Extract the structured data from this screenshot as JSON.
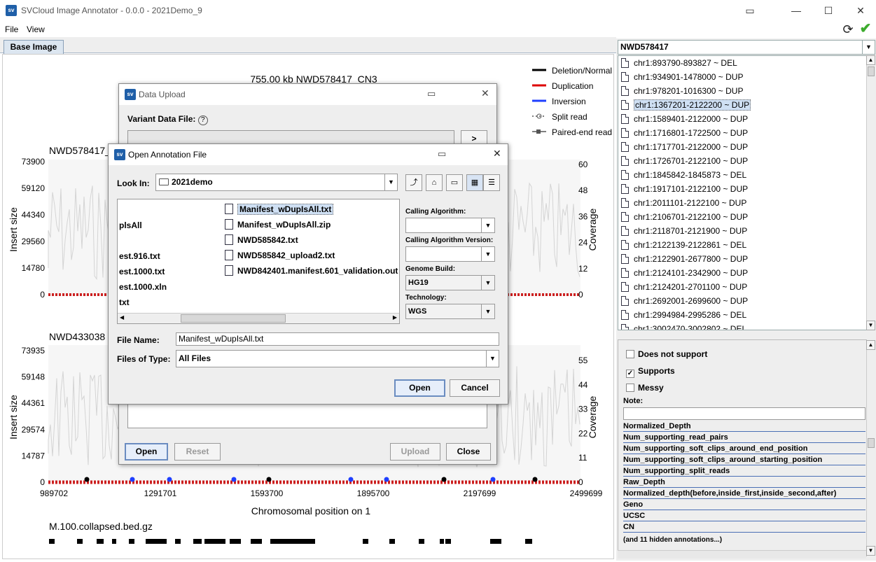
{
  "window": {
    "title": "SVCloud Image Annotator - 0.0.0 - 2021Demo_9",
    "icon_text": "sv",
    "controls": [
      "restore-icon",
      "minimize-icon",
      "maximize-icon",
      "close-icon"
    ]
  },
  "menu": {
    "file": "File",
    "view": "View"
  },
  "toolbar_icons": [
    "refresh-icon",
    "check-icon"
  ],
  "tab": {
    "label": "Base Image"
  },
  "plot": {
    "title": "755.00 kb NWD578417_CN3",
    "legend": [
      {
        "label": "Deletion/Normal",
        "color": "#000000"
      },
      {
        "label": "Duplication",
        "color": "#dd0000"
      },
      {
        "label": "Inversion",
        "color": "#1f3fff"
      },
      {
        "label": "Split read",
        "color": "#555555"
      },
      {
        "label": "Paired-end read",
        "color": "#555555"
      }
    ],
    "panel1": {
      "sample": "NWD578417_C",
      "y_ticks": [
        "73900",
        "59120",
        "44340",
        "29560",
        "14780",
        "0"
      ],
      "cov_ticks": [
        "60",
        "48",
        "36",
        "24",
        "12",
        "0"
      ]
    },
    "panel2": {
      "sample": "NWD433038",
      "y_ticks": [
        "73935",
        "59148",
        "44361",
        "29574",
        "14787",
        "0"
      ],
      "cov_ticks": [
        "55",
        "44",
        "33",
        "22",
        "11",
        "0"
      ]
    },
    "ylabel_left": "Insert size",
    "ylabel_right": "Coverage",
    "x_ticks": [
      "989702",
      "1291701",
      "1593700",
      "1895700",
      "2197699",
      "2499699"
    ],
    "xlabel": "Chromosomal position on 1",
    "bed_track": "M.100.collapsed.bed.gz"
  },
  "right": {
    "sample_combo": "NWD578417",
    "variants": [
      "chr1:893790-893827 ~ DEL",
      "chr1:934901-1478000 ~ DUP",
      "chr1:978201-1016300 ~ DUP",
      "chr1:1367201-2122200 ~ DUP",
      "chr1:1589401-2122000 ~ DUP",
      "chr1:1716801-1722500 ~ DUP",
      "chr1:1717701-2122000 ~ DUP",
      "chr1:1726701-2122100 ~ DUP",
      "chr1:1845842-1845873 ~ DEL",
      "chr1:1917101-2122100 ~ DUP",
      "chr1:2011101-2122100 ~ DUP",
      "chr1:2106701-2122100 ~ DUP",
      "chr1:2118701-2121900 ~ DUP",
      "chr1:2122139-2122861 ~ DEL",
      "chr1:2122901-2677800 ~ DUP",
      "chr1:2124101-2342900 ~ DUP",
      "chr1:2124201-2701100 ~ DUP",
      "chr1:2692001-2699600 ~ DUP",
      "chr1:2994984-2995286 ~ DEL",
      "chr1:3002470-3002802 ~ DEL"
    ],
    "selected_index": 3,
    "checks": [
      {
        "label": "Does not support",
        "checked": false
      },
      {
        "label": "Supports",
        "checked": true
      },
      {
        "label": "Messy",
        "checked": false
      }
    ],
    "note_label": "Note:",
    "annotations": [
      "Normalized_Depth",
      "Num_supporting_read_pairs",
      "Num_supporting_soft_clips_around_end_position",
      "Num_supporting_soft_clips_around_starting_position",
      "Num_supporting_split_reads",
      "Raw_Depth",
      "Normalized_depth(before,inside_first,inside_second,after)",
      "Geno",
      "UCSC",
      "CN"
    ],
    "hidden_note": "(and 11 hidden annotations...)"
  },
  "upload_dialog": {
    "title": "Data Upload",
    "variant_label": "Variant Data File:",
    "help": "?",
    "browse": ">",
    "open": "Open",
    "reset": "Reset",
    "upload": "Upload",
    "close": "Close"
  },
  "open_dialog": {
    "title": "Open Annotation File",
    "look_in_label": "Look In:",
    "look_in_value": "2021demo",
    "left_files": [
      "plsAll",
      "est.916.txt",
      "est.1000.txt",
      "est.1000.xln",
      "txt"
    ],
    "right_files": [
      "Manifest_wDupIsAll.txt",
      "Manifest_wDupIsAll.zip",
      "NWD585842.txt",
      "NWD585842_upload2.txt",
      "NWD842401.manifest.601_validation.out"
    ],
    "selected_file": "Manifest_wDupIsAll.txt",
    "calling_algorithm_label": "Calling Algorithm:",
    "calling_algorithm_value": "",
    "calling_version_label": "Calling Algorithm Version:",
    "calling_version_value": "",
    "genome_build_label": "Genome Build:",
    "genome_build_value": "HG19",
    "technology_label": "Technology:",
    "technology_value": "WGS",
    "file_name_label": "File Name:",
    "file_name_value": "Manifest_wDupIsAll.txt",
    "files_type_label": "Files of Type:",
    "files_type_value": "All Files",
    "open": "Open",
    "cancel": "Cancel"
  }
}
